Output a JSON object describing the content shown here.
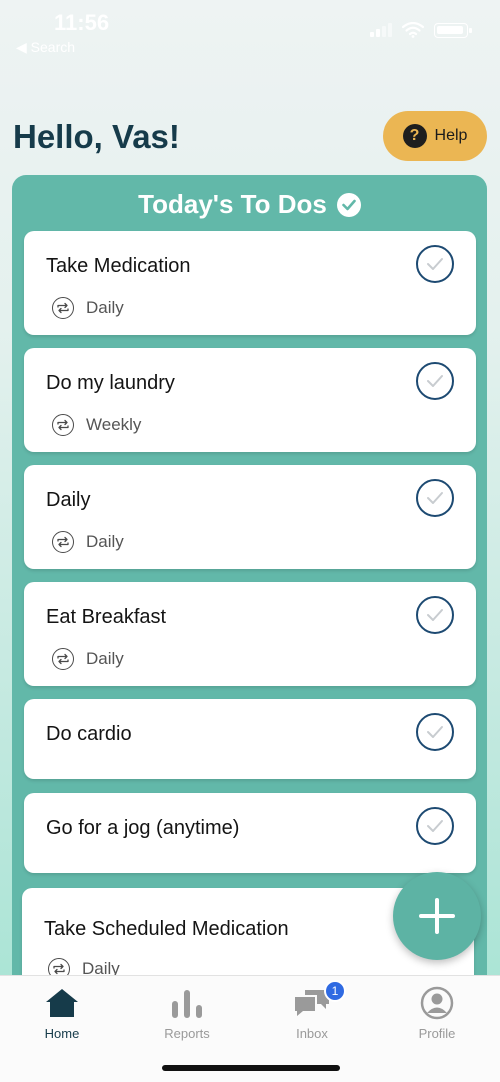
{
  "status": {
    "time": "11:56",
    "back_label": "◀ Search"
  },
  "greeting": "Hello, Vas!",
  "help": {
    "label": "Help",
    "icon": "help-icon"
  },
  "todos": {
    "title": "Today's To Dos",
    "items": [
      {
        "title": "Take Medication",
        "frequency": "Daily"
      },
      {
        "title": "Do my laundry",
        "frequency": "Weekly"
      },
      {
        "title": "Daily",
        "frequency": "Daily"
      },
      {
        "title": "Eat Breakfast",
        "frequency": "Daily"
      },
      {
        "title": "Do cardio",
        "frequency": ""
      },
      {
        "title": "Go for a jog (anytime)",
        "frequency": ""
      },
      {
        "title": "Take Scheduled Medication",
        "frequency": "Daily"
      }
    ]
  },
  "tabs": [
    {
      "label": "Home",
      "icon": "home-icon",
      "active": true
    },
    {
      "label": "Reports",
      "icon": "bar-chart-icon",
      "active": false
    },
    {
      "label": "Inbox",
      "icon": "chat-icon",
      "active": false,
      "badge": "1"
    },
    {
      "label": "Profile",
      "icon": "user-icon",
      "active": false
    }
  ],
  "colors": {
    "panel": "#62b8a9",
    "help": "#ebb653",
    "title": "#163b4a",
    "badge": "#2f6ae2"
  }
}
